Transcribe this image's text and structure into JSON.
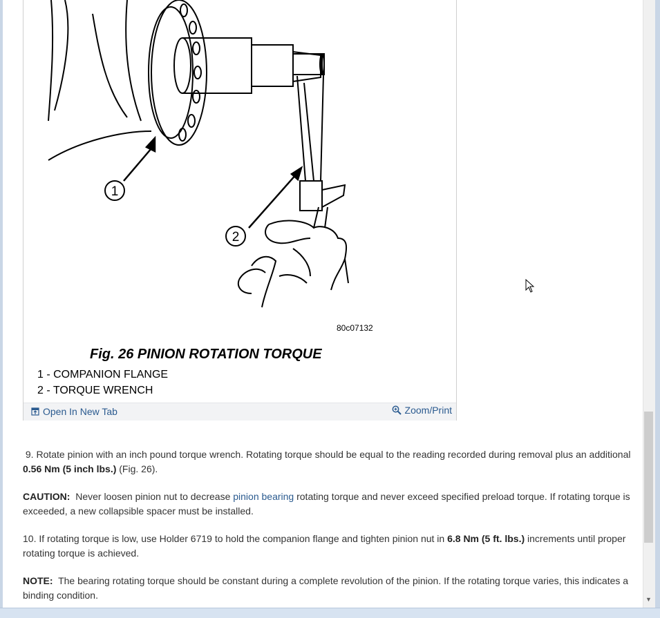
{
  "figure": {
    "id_label": "80c07132",
    "title": "Fig. 26 PINION ROTATION TORQUE",
    "callout_1": "1",
    "callout_2": "2",
    "legend": [
      "1 - COMPANION FLANGE",
      "2 - TORQUE WRENCH"
    ],
    "open_tab_label": "Open In New Tab",
    "zoom_label": "Zoom/Print"
  },
  "steps": {
    "step9": {
      "text_a": "9. Rotate pinion with an inch pound torque wrench. Rotating torque should be equal to the reading recorded during removal plus an additional ",
      "bold": "0.56 Nm (5 inch lbs.)",
      "text_b": " (Fig. 26)."
    },
    "caution": {
      "label": "CAUTION:",
      "text_a": "  Never loosen pinion nut to decrease ",
      "link": "pinion bearing",
      "text_b": " rotating torque and never exceed specified preload torque. If rotating torque is exceeded, a new collapsible spacer must be installed."
    },
    "step10": {
      "text_a": "10. If rotating torque is low, use Holder 6719 to hold the companion flange and tighten pinion nut in ",
      "bold": "6.8 Nm (5 ft. lbs.)",
      "text_b": " increments until proper rotating torque is achieved."
    },
    "note": {
      "label": "NOTE:",
      "text": "  The bearing rotating torque should be constant during a complete revolution of the pinion. If the rotating torque varies, this indicates a binding condition."
    }
  },
  "colors": {
    "link": "#2a5a8f",
    "text": "#333333"
  }
}
